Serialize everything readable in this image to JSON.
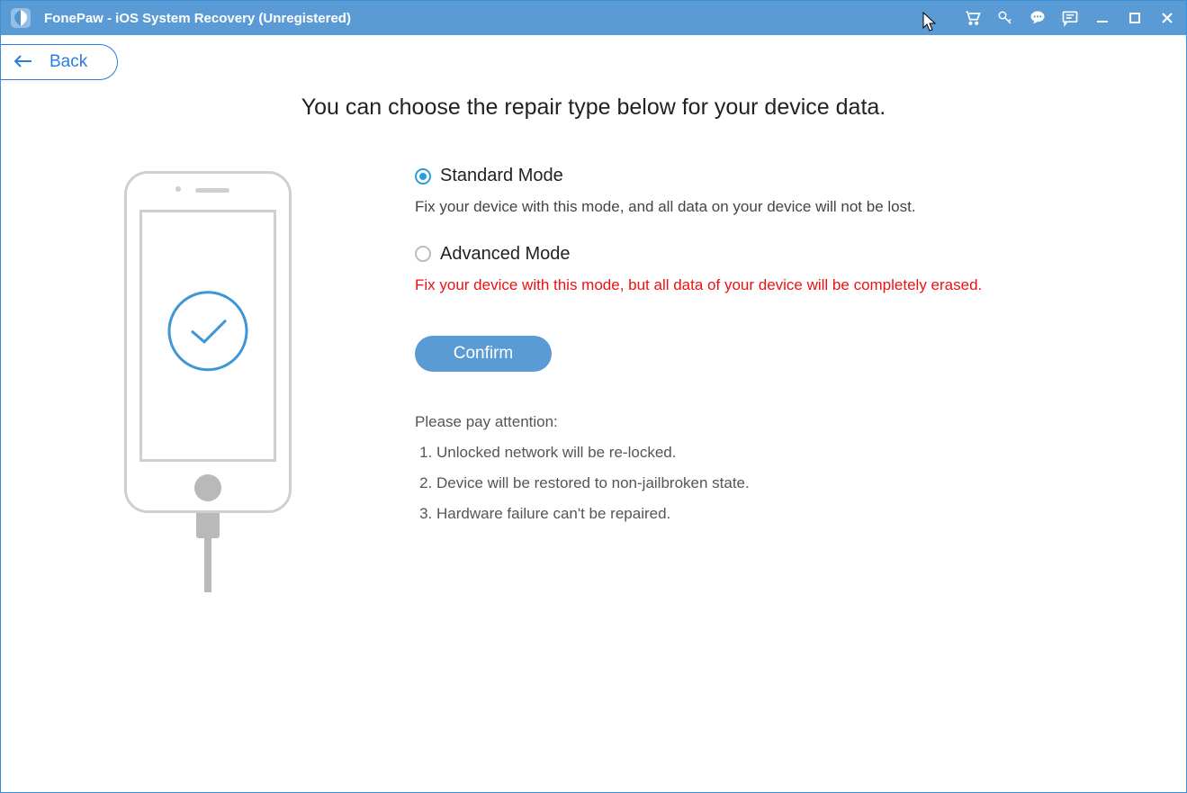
{
  "titlebar": {
    "title": "FonePaw - iOS System Recovery (Unregistered)"
  },
  "back": {
    "label": "Back"
  },
  "main": {
    "heading": "You can choose the repair type below for your device data.",
    "modes": {
      "standard": {
        "title": "Standard Mode",
        "desc": "Fix your device with this mode, and all data on your device will not be lost.",
        "selected": true
      },
      "advanced": {
        "title": "Advanced Mode",
        "desc": "Fix your device with this mode, but all data of your device will be completely erased.",
        "selected": false
      }
    },
    "confirm_label": "Confirm",
    "attention": {
      "heading": "Please pay attention:",
      "items": [
        "Unlocked network will be re-locked.",
        "Device will be restored to non-jailbroken state.",
        "Hardware failure can't be repaired."
      ]
    }
  }
}
